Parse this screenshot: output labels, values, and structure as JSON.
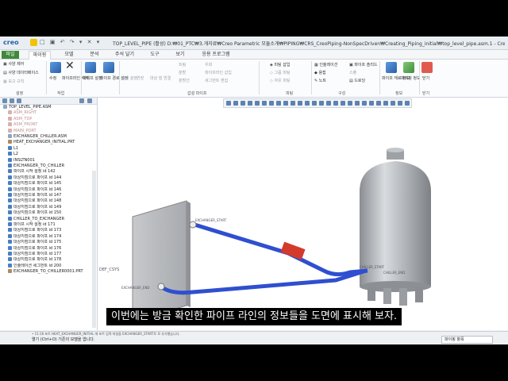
{
  "titlebar": {
    "logo": "creo",
    "title": "TOP_LEVEL_PIPE (활성) D:₩01_PTC₩3.개자료₩Creo Parametric 모듈소개₩PIPING₩CRS_CreoPiping-NonSpecDriven₩Creating_Piping_initial₩top_level_pipe.asm.1 - Creo"
  },
  "tabs": [
    "파일",
    "파이핑",
    "모델",
    "분석",
    "주석 달기",
    "도구",
    "보기",
    "응용 프로그램"
  ],
  "ribbon": {
    "setup": {
      "items": [
        "사양 제어",
        "사양 데이터베이스",
        "보고 규칙"
      ],
      "label": "설정"
    },
    "work": {
      "items": [
        "수정",
        "파이프라인 삭제"
      ],
      "label": "작업"
    },
    "pipe_lines": {
      "items": [
        "파이프 설정",
        "파이프 경로 설정"
      ]
    },
    "create_pipe": {
      "items": [
        "시작 설정",
        "연장",
        "대상 점",
        "연결"
      ],
      "small": [
        "트림",
        "분할",
        "분할선",
        "우회",
        "파이프라인 삽입",
        "세그먼트 편집",
        "개행",
        "고정 순서 이동"
      ],
      "label": "갑설 파이프"
    },
    "fitting": {
      "items": [
        "피팅 삽입",
        "그룹 피팅",
        "자유 피팅"
      ],
      "label": "피팅"
    },
    "structure": {
      "items": [
        "인슐레이션",
        "파이프 솔리드",
        "스풀",
        "용접",
        "노트",
        "드로잉"
      ],
      "label": "구성"
    },
    "info": {
      "items": [
        "파이프 재료 정보",
        "파이핑 정보"
      ],
      "label": "정보"
    },
    "exit": {
      "items": [
        "닫기"
      ],
      "label": "닫기"
    }
  },
  "tree": [
    {
      "label": "TOP_LEVEL_PIPE.ASM",
      "kind": "asm"
    },
    {
      "label": "ASM_RIGHT",
      "kind": "datum"
    },
    {
      "label": "ASM_TOP",
      "kind": "datum"
    },
    {
      "label": "ASM_FRONT",
      "kind": "datum"
    },
    {
      "label": "MAIN_PORT",
      "kind": "datum"
    },
    {
      "label": "EXCHANGER_CHILLER.ASM",
      "kind": "asm"
    },
    {
      "label": "HEAT_EXCHANGER_INITIAL.PRT",
      "kind": "part"
    },
    {
      "label": "L1",
      "kind": "pipe"
    },
    {
      "label": "L2",
      "kind": "pipe"
    },
    {
      "label": "INSLTN001",
      "kind": "pipe"
    },
    {
      "label": "EXCHANGER_TO_CHILLER",
      "kind": "pipe"
    },
    {
      "label": "파이프 시작 설정 id 142",
      "kind": "pipe"
    },
    {
      "label": "대상지점으로 파이프 id 144",
      "kind": "pipe"
    },
    {
      "label": "대상지점으로 파이프 id 145",
      "kind": "pipe"
    },
    {
      "label": "대상지점으로 파이프 id 146",
      "kind": "pipe"
    },
    {
      "label": "대상지점으로 파이프 id 147",
      "kind": "pipe"
    },
    {
      "label": "대상지점으로 파이프 id 148",
      "kind": "pipe"
    },
    {
      "label": "대상지점으로 파이프 id 149",
      "kind": "pipe"
    },
    {
      "label": "대상지점으로 파이프 id 150",
      "kind": "pipe"
    },
    {
      "label": "CHILLER_TO_EXCHANGER",
      "kind": "pipe"
    },
    {
      "label": "파이프 시작 설정 id 171",
      "kind": "pipe"
    },
    {
      "label": "대상지점으로 파이프 id 173",
      "kind": "pipe"
    },
    {
      "label": "대상지점으로 파이프 id 174",
      "kind": "pipe"
    },
    {
      "label": "대상지점으로 파이프 id 175",
      "kind": "pipe"
    },
    {
      "label": "대상지점으로 파이프 id 176",
      "kind": "pipe"
    },
    {
      "label": "대상지점으로 파이프 id 177",
      "kind": "pipe"
    },
    {
      "label": "대상지점으로 파이프 id 178",
      "kind": "pipe"
    },
    {
      "label": "인슐레이션 세그먼트 id 200",
      "kind": "pipe"
    },
    {
      "label": "EXCHANGER_TO_CHILLER0001.PRT",
      "kind": "part"
    }
  ],
  "graphics": {
    "labels": [
      "DEF_CSYS",
      "EXCHANGER_START",
      "EXCHANGER_END",
      "CHILLER_START",
      "CHILLER_END"
    ]
  },
  "status": {
    "line1": "• 11:16 포트 HEAT_EXCHANGER_INITIAL 에 포트 입력 파일을 EXCHANGER_START로 로 추가했습니다.",
    "line2": "열기 (Ctrl+O) 기존의 모델을 엽니다.",
    "filter": "파이핑 항목"
  },
  "subtitle": "이번에는 방금 확인한 파이프 라인의 정보들을 도면에 표시해 보자.",
  "colors": {
    "pipe": "#2f4fd0",
    "file_tab": "#3f8a3a",
    "tank": "#a9adb2",
    "valve": "#d33a2c"
  }
}
